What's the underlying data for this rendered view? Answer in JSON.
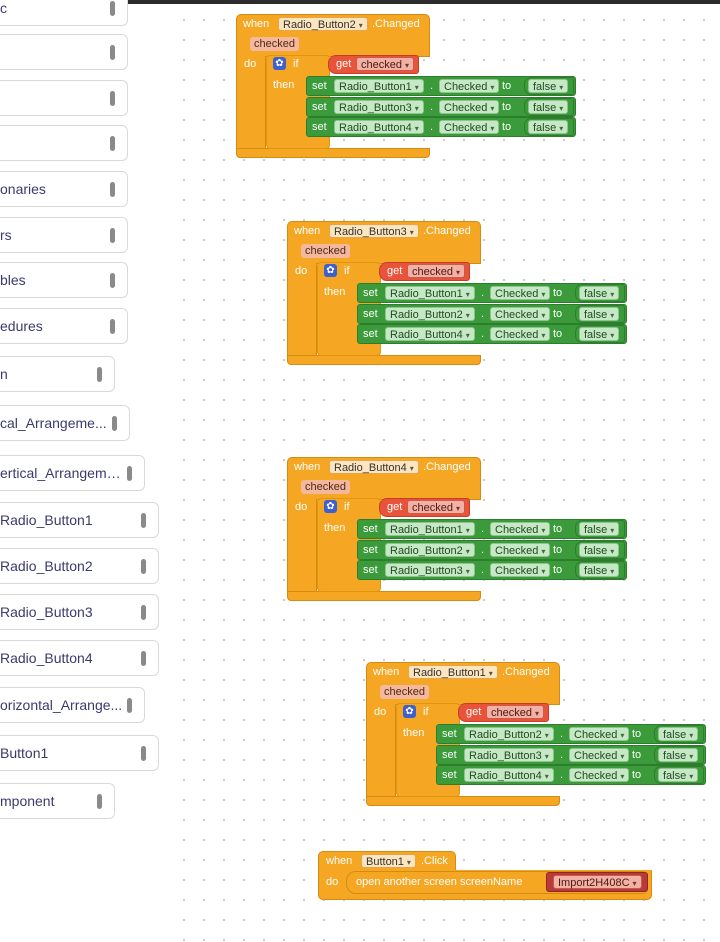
{
  "palette": {
    "items": [
      {
        "label": "c"
      },
      {
        "label": ""
      },
      {
        "label": ""
      },
      {
        "label": ""
      },
      {
        "label": "onaries"
      },
      {
        "label": "rs"
      },
      {
        "label": "bles"
      },
      {
        "label": "edures"
      },
      {
        "label": "n"
      },
      {
        "label": "cal_Arrangeme..."
      },
      {
        "label": "ertical_Arrangeme..."
      },
      {
        "label": "Radio_Button1"
      },
      {
        "label": "Radio_Button2"
      },
      {
        "label": "Radio_Button3"
      },
      {
        "label": "Radio_Button4"
      },
      {
        "label": "orizontal_Arrange..."
      },
      {
        "label": "Button1"
      },
      {
        "label": "mponent"
      }
    ]
  },
  "common": {
    "when": "when",
    "changed": ".Changed",
    "checked_param": "checked",
    "do": "do",
    "if": "if",
    "then": "then",
    "get": "get",
    "set": "set",
    "dot": ".",
    "prop": "Checked",
    "to": "to",
    "false": "false",
    "gear": "✿"
  },
  "events": [
    {
      "component": "Radio_Button2",
      "targets": [
        "Radio_Button1",
        "Radio_Button3",
        "Radio_Button4"
      ]
    },
    {
      "component": "Radio_Button3",
      "targets": [
        "Radio_Button1",
        "Radio_Button2",
        "Radio_Button4"
      ]
    },
    {
      "component": "Radio_Button4",
      "targets": [
        "Radio_Button1",
        "Radio_Button2",
        "Radio_Button3"
      ]
    },
    {
      "component": "Radio_Button1",
      "targets": [
        "Radio_Button2",
        "Radio_Button3",
        "Radio_Button4"
      ]
    }
  ],
  "click_event": {
    "when": "when",
    "component": "Button1",
    "event": ".Click",
    "do": "do",
    "action": "open another screen  screenName",
    "screen_name": "Import2H408C"
  },
  "colors": {
    "event": "#f5a623",
    "setter": "#3b9b3b",
    "getter": "#e8533a",
    "control_gear": "#3f5fcf"
  }
}
